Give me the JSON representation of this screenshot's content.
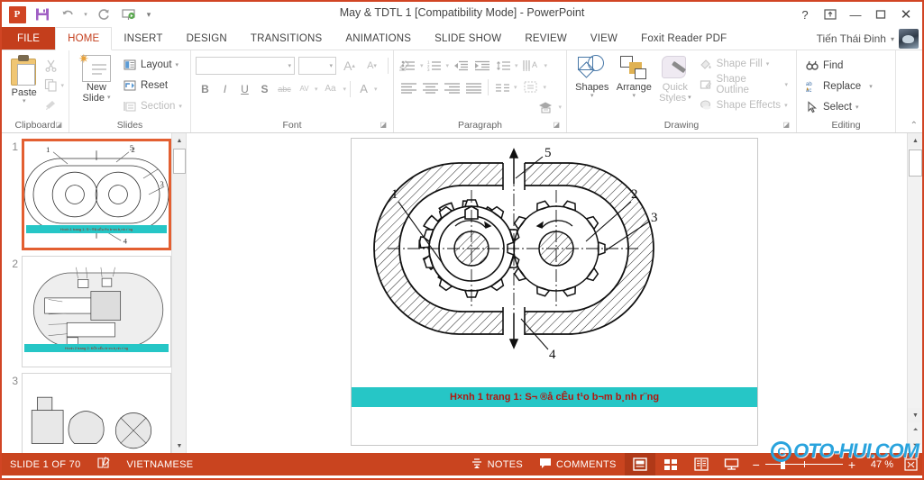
{
  "window": {
    "title": "May & TDTL 1 [Compatibility Mode] - PowerPoint",
    "user_name": "Tiến Thái Đinh",
    "help": "?",
    "ribbon_display": "⛊",
    "minimize": "—",
    "maximize": "▢",
    "close": "✕",
    "accent_color": "#c9441f"
  },
  "quick_access": {
    "app_badge": "P",
    "save": "save-icon",
    "undo": "↰",
    "undo_caret": "▾",
    "redo": "↻",
    "present": "present-icon",
    "customize": "▾"
  },
  "tabs": [
    {
      "label": "FILE",
      "state": "file"
    },
    {
      "label": "HOME",
      "state": "active"
    },
    {
      "label": "INSERT",
      "state": "normal"
    },
    {
      "label": "DESIGN",
      "state": "normal"
    },
    {
      "label": "TRANSITIONS",
      "state": "normal"
    },
    {
      "label": "ANIMATIONS",
      "state": "normal"
    },
    {
      "label": "SLIDE SHOW",
      "state": "normal"
    },
    {
      "label": "REVIEW",
      "state": "normal"
    },
    {
      "label": "VIEW",
      "state": "normal"
    },
    {
      "label": "Foxit Reader PDF",
      "state": "normal"
    }
  ],
  "ribbon": {
    "clipboard": {
      "group_label": "Clipboard",
      "paste": "Paste",
      "paste_arrow": "▾",
      "cut": "✄",
      "copy": "copy-icon",
      "copy_arrow": "▾",
      "format_painter": "format-painter-icon",
      "dialog_launcher": "◪"
    },
    "slides": {
      "group_label": "Slides",
      "new_slide_l1": "New",
      "new_slide_l2": "Slide",
      "new_slide_arrow": "▾",
      "layout": "Layout",
      "layout_arrow": "▾",
      "reset": "Reset",
      "section": "Section",
      "section_arrow": "▾"
    },
    "font": {
      "group_label": "Font",
      "font_name_value": "",
      "font_size_value": "",
      "dropdown_caret": "▾",
      "grow_font": "A",
      "shrink_font": "A",
      "clear_formatting": "⌫",
      "bold": "B",
      "italic": "I",
      "underline": "U",
      "shadow": "S",
      "strikethrough": "abc",
      "char_spacing": "AV",
      "change_case": "Aa",
      "font_color": "A",
      "dialog_launcher": "◪"
    },
    "paragraph": {
      "group_label": "Paragraph",
      "bullets": "bullets-icon",
      "numbering": "numbering-icon",
      "decrease_indent": "◄≡",
      "increase_indent": "≡►",
      "line_spacing": "line-spacing-icon",
      "text_direction": "text-direction-icon",
      "align_text": "align-text-icon",
      "convert_smartart": "smartart-icon",
      "align_left": "≡",
      "align_center": "≡",
      "align_right": "≡",
      "justify": "≡",
      "columns": "columns-icon",
      "dialog_launcher": "◪"
    },
    "drawing": {
      "group_label": "Drawing",
      "shapes": "Shapes",
      "shapes_arrow": "▾",
      "arrange": "Arrange",
      "arrange_arrow": "▾",
      "quick_styles_l1": "Quick",
      "quick_styles_l2": "Styles",
      "quick_styles_arrow": "▾",
      "shape_fill": "Shape Fill",
      "shape_outline": "Shape Outline",
      "shape_effects": "Shape Effects",
      "menu_arrow": "▾",
      "dialog_launcher": "◪"
    },
    "editing": {
      "group_label": "Editing",
      "find": "Find",
      "replace": "Replace",
      "replace_arrow": "▾",
      "select": "Select",
      "select_arrow": "▾"
    },
    "collapse_ribbon": "⌃"
  },
  "slide_panel": {
    "slides": [
      {
        "number": "1",
        "caption": "H×nh 1 trang 1: S¬ ®å cÊu t¹o b¬m b¸nh r¨ng",
        "selected": true
      },
      {
        "number": "2",
        "caption": "H×nh 2 trang 2: KÕt cÊu b¬m b¸nh r¨ng",
        "selected": false
      },
      {
        "number": "3",
        "caption": "",
        "selected": false
      }
    ],
    "scroll_up": "▲",
    "scroll_down": "▼"
  },
  "slide": {
    "caption": "H×nh 1 trang 1: S¬ ®å cÊu t¹o b¬m b¸nh r¨ng",
    "caption_bg": "#26c6c6",
    "caption_color": "#b3150d",
    "callouts": [
      "1",
      "2",
      "3",
      "4",
      "5"
    ]
  },
  "editor_scroll": {
    "up": "▲",
    "down": "▼",
    "prev_slide": "⏶",
    "next_slide": "⏷"
  },
  "status_bar": {
    "slide_indicator": "SLIDE 1 OF 70",
    "language": "VIETNAMESE",
    "notes": "NOTES",
    "comments": "COMMENTS",
    "notes_icon": "notes-icon",
    "comments_icon": "comment-icon",
    "spellcheck_icon": "spellcheck-icon",
    "view_normal": "normal-view-icon",
    "view_sorter": "slide-sorter-icon",
    "view_reading": "reading-view-icon",
    "view_slideshow": "slideshow-icon",
    "zoom_out": "−",
    "zoom_in": "+",
    "zoom_level": "47 %",
    "fit_slide": "fit-icon"
  },
  "watermark": {
    "symbol": "C",
    "text": "OTO-HUI.COM",
    "color": "#29a3dd"
  }
}
